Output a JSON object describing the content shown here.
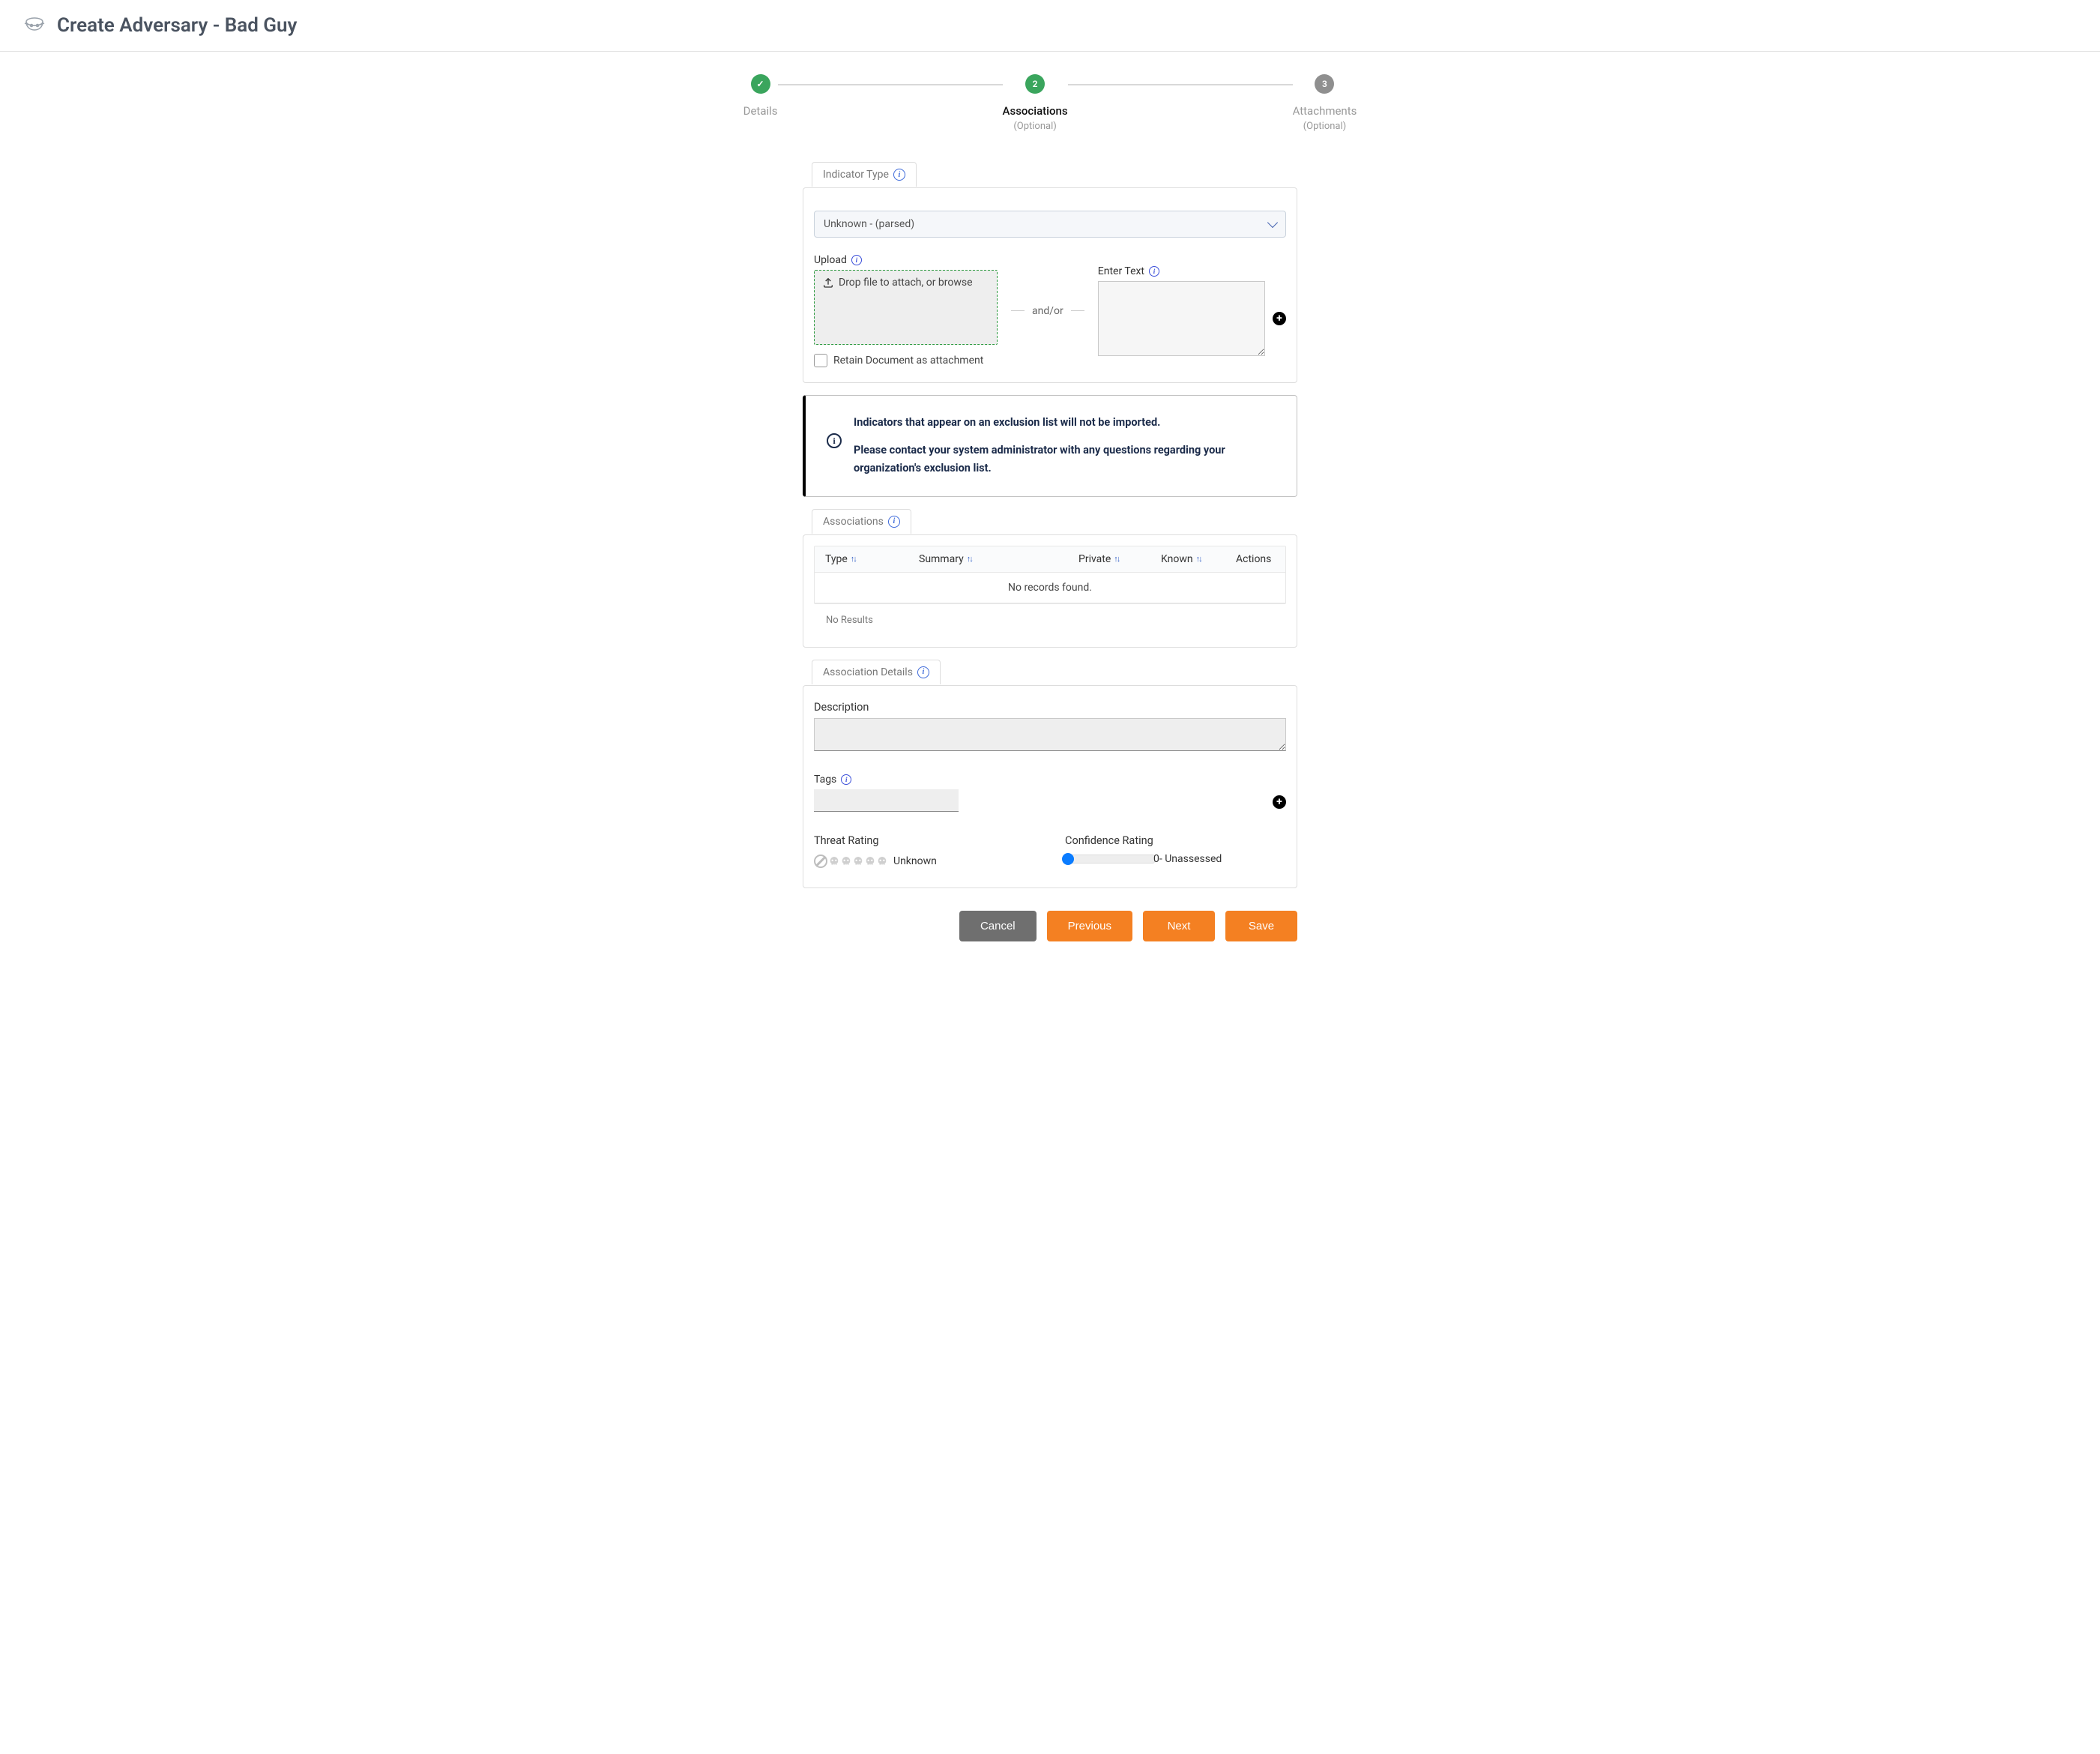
{
  "header": {
    "title": "Create Adversary - Bad Guy"
  },
  "stepper": {
    "steps": [
      {
        "label": "Details",
        "sub": "",
        "state": "completed"
      },
      {
        "label": "Associations",
        "sub": "(Optional)",
        "state": "current",
        "number": "2"
      },
      {
        "label": "Attachments",
        "sub": "(Optional)",
        "state": "upcoming",
        "number": "3"
      }
    ]
  },
  "indicatorSection": {
    "tab": "Indicator Type",
    "selectValue": "Unknown - (parsed)",
    "uploadLabel": "Upload",
    "dropText": "Drop file to attach, or browse",
    "andOr": "and/or",
    "enterTextLabel": "Enter Text",
    "retainLabel": "Retain Document as attachment"
  },
  "alert": {
    "line1": "Indicators that appear on an exclusion list will not be imported.",
    "line2": "Please contact your system administrator with any questions regarding your organization's exclusion list."
  },
  "associationsSection": {
    "tab": "Associations",
    "headers": {
      "type": "Type",
      "summary": "Summary",
      "private": "Private",
      "known": "Known",
      "actions": "Actions"
    },
    "noRecords": "No records found.",
    "noResults": "No Results"
  },
  "detailsSection": {
    "tab": "Association Details",
    "descriptionLabel": "Description",
    "tagsLabel": "Tags",
    "threatLabel": "Threat Rating",
    "threatValue": "Unknown",
    "confidenceLabel": "Confidence Rating",
    "confidenceValue": "0- Unassessed"
  },
  "buttons": {
    "cancel": "Cancel",
    "previous": "Previous",
    "next": "Next",
    "save": "Save"
  }
}
